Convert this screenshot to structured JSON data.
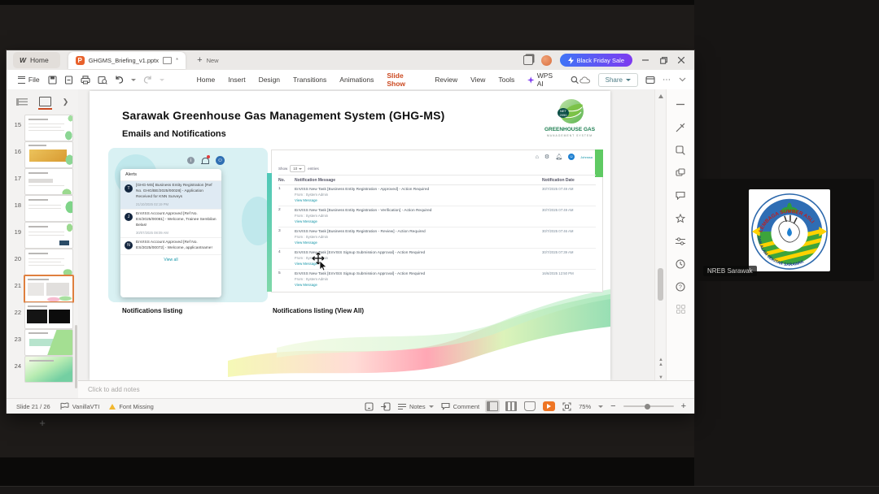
{
  "meeting": {
    "participant_name": "NREB Sarawak"
  },
  "titlebar": {
    "home_tab": "Home",
    "doc_tab": "GHGMS_Briefing_v1.pptx",
    "modified_indicator": "*",
    "new_tab": "New",
    "sale_button": "Black Friday Sale"
  },
  "toolbar": {
    "file": "File",
    "menus": [
      "Home",
      "Insert",
      "Design",
      "Transitions",
      "Animations",
      "Slide Show",
      "Review",
      "View",
      "Tools"
    ],
    "wps_ai": "WPS AI",
    "share": "Share"
  },
  "slide_panel": {
    "slides": [
      {
        "n": "15"
      },
      {
        "n": "16"
      },
      {
        "n": "17"
      },
      {
        "n": "18"
      },
      {
        "n": "19"
      },
      {
        "n": "20"
      },
      {
        "n": "21"
      },
      {
        "n": "22"
      },
      {
        "n": "23"
      },
      {
        "n": "24"
      }
    ],
    "add_label": "+"
  },
  "slide": {
    "title": "Sarawak Greenhouse Gas Management System (GHG-MS)",
    "subtitle": "Emails and Notifications",
    "logo": {
      "line1": "GREENHOUSE GAS",
      "line2": "MANAGEMENT SYSTEM",
      "badge_top": "NET",
      "badge_bottom": "2050"
    },
    "caption_left": "Notifications listing",
    "caption_right": "Notifications listing (View All)",
    "alerts": {
      "header": "Alerts",
      "items": [
        {
          "initial": "T",
          "text": "[GHG-MS] Business Entity Registration [Ref No. GHG/BE/2025/00028] - Application Received for KNN Surveys",
          "time": "21/10/2025 02:19 PM"
        },
        {
          "initial": "J",
          "text": "EnVISS Account Approved [Ref No. ES/2025/00081] - Welcome, Trainee Sembilan Belas!",
          "time": "30/07/2025 08:09 AM"
        },
        {
          "initial": "N",
          "text": "EnVISS Account Approved [Ref No. ES/2025/00072] - Welcome, applicantname!",
          "time": ""
        }
      ],
      "view_all": "View all"
    },
    "table": {
      "user": "Johnssa",
      "show": "Show",
      "show_value": "10",
      "entries": "entries",
      "columns": [
        "No.",
        "Notification Message",
        "Notification Date"
      ],
      "rows": [
        {
          "no": "1",
          "msg": "EnVISS New Task [Business Entity Registration - Approved] - Action Required",
          "from": "From : System Admin",
          "link": "View Message",
          "date": "30/7/2025 07:49 AM"
        },
        {
          "no": "2",
          "msg": "EnVISS New Task [Business Entity Registration - Verification] - Action Required",
          "from": "From : System Admin",
          "link": "View Message",
          "date": "30/7/2025 07:49 AM"
        },
        {
          "no": "3",
          "msg": "EnVISS New Task [Business Entity Registration - Review] - Action Required",
          "from": "From : System Admin",
          "link": "View Message",
          "date": "30/7/2025 07:46 AM"
        },
        {
          "no": "4",
          "msg": "EnVISS New Task [EnVISS Signup Submission Approval] - Action Required",
          "from": "From : System Admin",
          "link": "View Message",
          "date": "30/7/2025 07:39 AM"
        },
        {
          "no": "5",
          "msg": "EnVISS New Task [EnVISS Signup Submission Approval] - Action Required",
          "from": "From : System Admin",
          "link": "View Message",
          "date": "16/6/2025 12:50 PM"
        }
      ]
    }
  },
  "notes": {
    "placeholder": "Click to add notes"
  },
  "statusbar": {
    "slide_indicator": "Slide 21 / 26",
    "theme": "VanillaVTI",
    "font_missing": "Font Missing",
    "notes": "Notes",
    "comment": "Comment",
    "zoom": "75%"
  },
  "colors": {
    "accent_orange": "#cc4a21",
    "sale_gradient_start": "#3f74f6",
    "sale_gradient_end": "#7e3bf0",
    "link_teal": "#1596a8",
    "play_orange": "#ee7524"
  }
}
